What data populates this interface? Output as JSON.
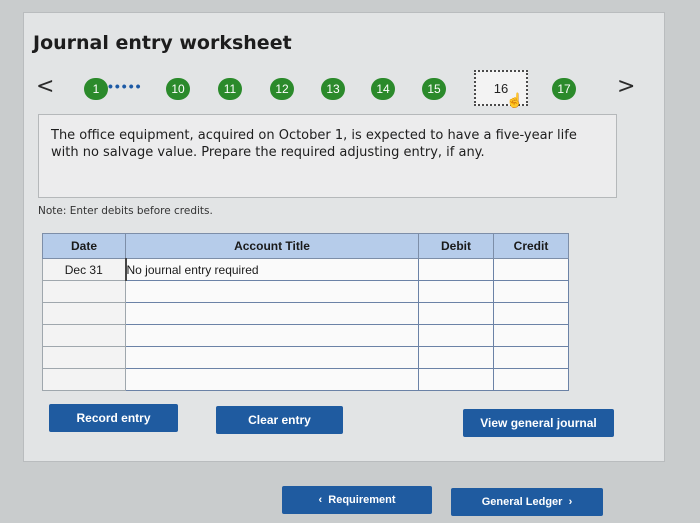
{
  "worksheet": {
    "title": "Journal entry worksheet",
    "steps": [
      "1",
      "10",
      "11",
      "12",
      "13",
      "14",
      "15",
      "16",
      "17"
    ],
    "ellipsis": "•••••",
    "current_step": "16",
    "prev_arrow": "<",
    "next_arrow": ">"
  },
  "question": {
    "text": "The office equipment, acquired on October 1, is expected to have a five-year life with no salvage value. Prepare the required adjusting entry, if any."
  },
  "note": "Note: Enter debits before credits.",
  "table": {
    "headers": {
      "date": "Date",
      "account": "Account Title",
      "debit": "Debit",
      "credit": "Credit"
    },
    "rows": [
      {
        "date": "Dec 31",
        "account": "No journal entry required",
        "debit": "",
        "credit": ""
      },
      {
        "date": "",
        "account": "",
        "debit": "",
        "credit": ""
      },
      {
        "date": "",
        "account": "",
        "debit": "",
        "credit": ""
      },
      {
        "date": "",
        "account": "",
        "debit": "",
        "credit": ""
      },
      {
        "date": "",
        "account": "",
        "debit": "",
        "credit": ""
      },
      {
        "date": "",
        "account": "",
        "debit": "",
        "credit": ""
      }
    ]
  },
  "buttons": {
    "record": "Record entry",
    "clear": "Clear entry",
    "view_general_journal": "View general journal",
    "requirement": "Requirement",
    "general_ledger": "General Ledger"
  },
  "colors": {
    "step_green": "#2b8a2b",
    "button_blue": "#1f5ba0",
    "header_blue": "#b6ccea"
  }
}
